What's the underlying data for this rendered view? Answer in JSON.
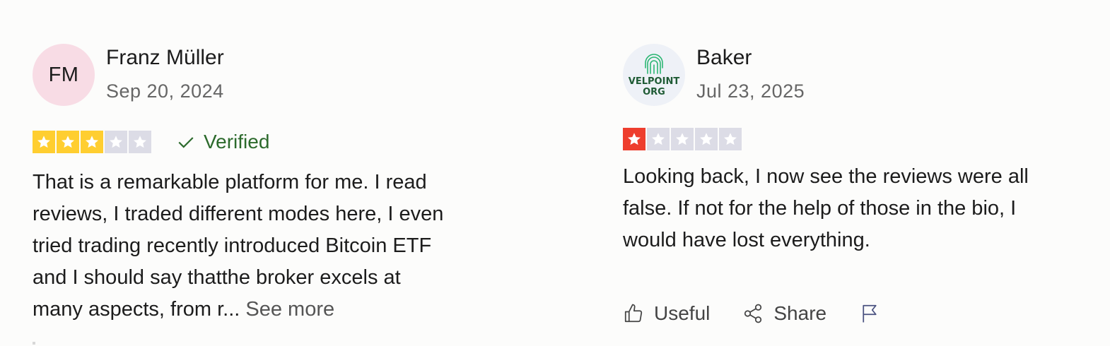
{
  "reviews": [
    {
      "avatar_initials": "FM",
      "avatar_color": "#f8dce5",
      "name": "Franz Müller",
      "date": "Sep 20, 2024",
      "rating": 3,
      "star_color": "#ffce30",
      "verified_label": "Verified",
      "text_lines": [
        "That is a remarkable platform for me. I read",
        "reviews, I traded different modes here, I even",
        "tried trading recently introduced Bitcoin ETF",
        "and I should say thatthe broker excels at",
        "many aspects, from r..."
      ],
      "see_more_label": "See more"
    },
    {
      "avatar_logo_lines": [
        "VELPOINT",
        "ORG"
      ],
      "avatar_logo_icon": "fingerprint-icon",
      "name": "Baker",
      "date": "Jul 23, 2025",
      "rating": 1,
      "star_color": "#ee3e2e",
      "text_lines": [
        "Looking back, I now see the reviews were all",
        "false. If not for the help of those in the bio, I",
        "would have lost everything."
      ],
      "actions": {
        "useful_label": "Useful",
        "share_label": "Share",
        "report_icon": "flag-icon"
      }
    }
  ]
}
